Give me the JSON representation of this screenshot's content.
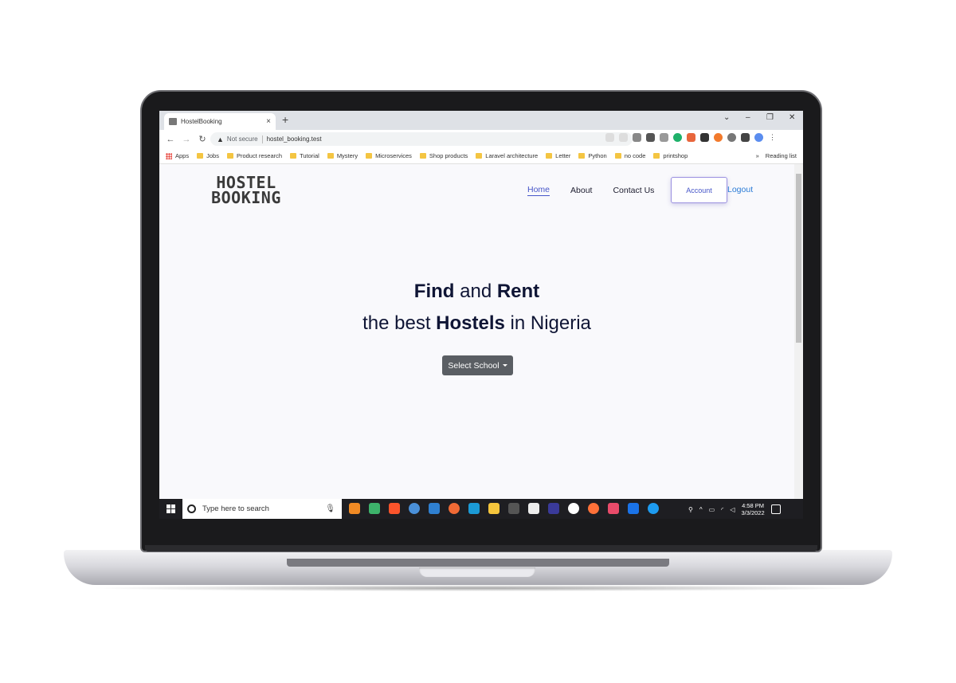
{
  "browser": {
    "tab_title": "HostelBooking",
    "tab_close": "×",
    "new_tab": "+",
    "window_controls": [
      "⌄",
      "–",
      "❐",
      "✕"
    ],
    "security": "Not secure",
    "url": "hostel_booking.test",
    "bookmarks": [
      "Apps",
      "Jobs",
      "Product research",
      "Tutorial",
      "Mystery",
      "Microservices",
      "Shop products",
      "Laravel architecture",
      "Letter",
      "Python",
      "no code",
      "printshop"
    ],
    "bookmarks_more": "»",
    "reading_list": "Reading list"
  },
  "site": {
    "logo_line1": "HOSTEL",
    "logo_line2": "BOOKING",
    "nav": {
      "home": "Home",
      "about": "About",
      "contact": "Contact Us",
      "account": "Account",
      "logout": "Logout"
    },
    "hero": {
      "find": "Find",
      "and": " and ",
      "rent": "Rent",
      "the_best": "the best ",
      "hostels": "Hostels",
      "in_nigeria": " in Nigeria"
    },
    "select_school": "Select School"
  },
  "taskbar": {
    "search_placeholder": "Type here to search",
    "time": "4:58 PM",
    "date": "3/3/2022"
  },
  "colors": {
    "accent": "#4655c8",
    "logout": "#2a7bd6",
    "heading": "#0f1535",
    "button": "#5a5e63"
  }
}
